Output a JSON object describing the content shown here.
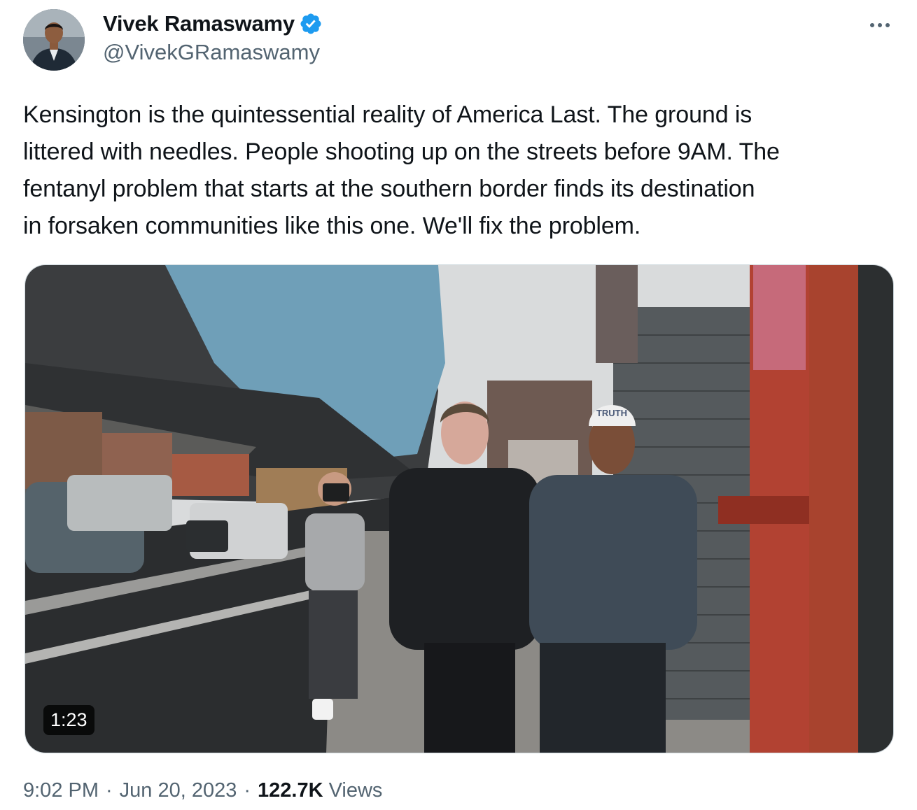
{
  "author": {
    "display_name": "Vivek Ramaswamy",
    "handle": "@VivekGRamaswamy",
    "verified": true,
    "verified_color": "#1d9bf0"
  },
  "tweet": {
    "text_lines": [
      "Kensington is the quintessential reality of America Last. The ground is",
      "littered with needles. People shooting up on the streets before 9AM. The",
      "fentanyl problem that starts at the southern border finds its destination",
      "in forsaken communities like this one. We'll fix the problem."
    ]
  },
  "media": {
    "type": "video",
    "duration": "1:23",
    "cap_text": "TRUTH"
  },
  "meta": {
    "time": "9:02 PM",
    "separator": "·",
    "date": "Jun 20, 2023",
    "views_count": "122.7K",
    "views_label": "Views"
  },
  "icons": {
    "more": "more-horizontal-icon",
    "verified": "verified-badge-icon"
  }
}
